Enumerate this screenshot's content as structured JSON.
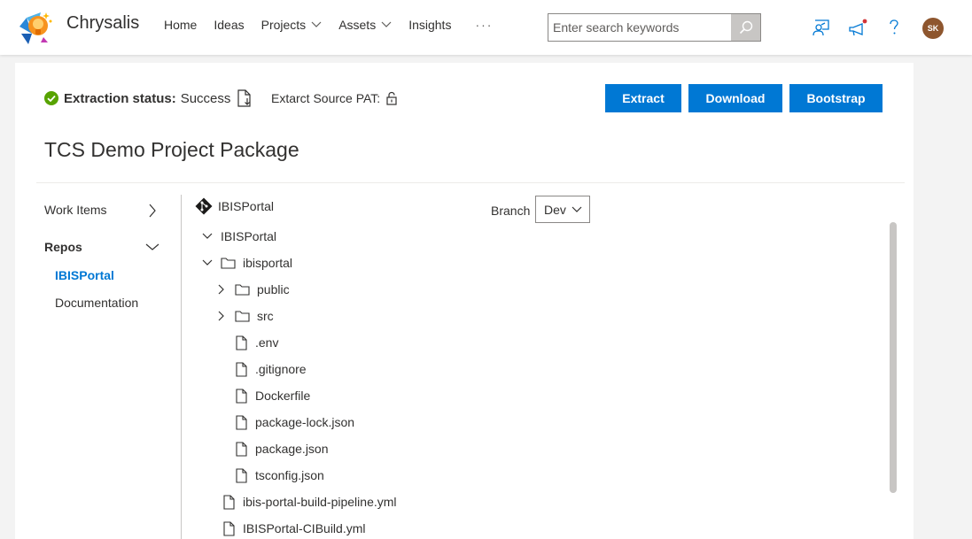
{
  "app": {
    "brand": "Chrysalis"
  },
  "nav": {
    "items": [
      {
        "label": "Home",
        "dropdown": false
      },
      {
        "label": "Ideas",
        "dropdown": false
      },
      {
        "label": "Projects",
        "dropdown": true
      },
      {
        "label": "Assets",
        "dropdown": true
      },
      {
        "label": "Insights",
        "dropdown": false
      }
    ],
    "more": "···"
  },
  "search": {
    "placeholder": "Enter search keywords"
  },
  "user": {
    "initials": "SK",
    "avatar_color": "#8e562e"
  },
  "status": {
    "label": "Extraction status:",
    "value": "Success",
    "pat_label": "Extarct Source PAT:"
  },
  "actions": {
    "extract": "Extract",
    "download": "Download",
    "bootstrap": "Bootstrap"
  },
  "page": {
    "title": "TCS Demo Project Package"
  },
  "sidebar": {
    "work_items": "Work Items",
    "repos": "Repos",
    "repo_items": [
      "IBISPortal",
      "Documentation"
    ]
  },
  "repo": {
    "name": "IBISPortal"
  },
  "branch": {
    "label": "Branch",
    "value": "Dev"
  },
  "tree": [
    {
      "name": "IBISPortal",
      "type": "root",
      "expanded": true
    },
    {
      "name": "ibisportal",
      "type": "folder",
      "expanded": true
    },
    {
      "name": "public",
      "type": "folder",
      "expanded": false
    },
    {
      "name": "src",
      "type": "folder",
      "expanded": false
    },
    {
      "name": ".env",
      "type": "file"
    },
    {
      "name": ".gitignore",
      "type": "file"
    },
    {
      "name": "Dockerfile",
      "type": "file"
    },
    {
      "name": "package-lock.json",
      "type": "file"
    },
    {
      "name": "package.json",
      "type": "file"
    },
    {
      "name": "tsconfig.json",
      "type": "file"
    },
    {
      "name": "ibis-portal-build-pipeline.yml",
      "type": "file"
    },
    {
      "name": "IBISPortal-CIBuild.yml",
      "type": "file"
    }
  ],
  "colors": {
    "accent": "#0078d4",
    "success": "#57a300",
    "active_link": "#0078d4"
  }
}
